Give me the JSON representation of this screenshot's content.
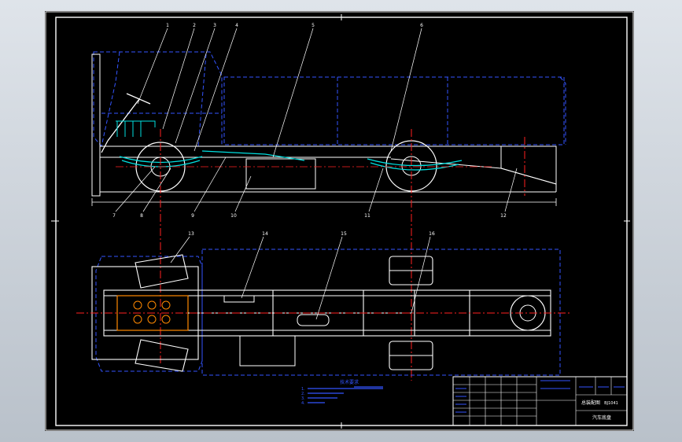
{
  "drawing": {
    "background": "#000000",
    "frame_color": "#ffffff",
    "colors": {
      "outline": "#ffffff",
      "hidden": "#3355ff",
      "center": "#ff2020",
      "spring": "#00e0e0",
      "accent": "#ffff00",
      "leader": "#ffffff"
    },
    "side_view": {
      "balloons": [
        "1",
        "2",
        "3",
        "4",
        "5",
        "6"
      ],
      "bottom_callouts": [
        "7",
        "8",
        "9",
        "10",
        "11",
        "12"
      ]
    },
    "plan_view": {
      "balloons": [
        "13",
        "14",
        "15",
        "16"
      ]
    },
    "notes": {
      "heading": "技术要求",
      "lines": [
        "1.",
        "2.",
        "3.",
        "4."
      ]
    },
    "title_block": {
      "title": "总装配图",
      "drawing_no": "BJ1041",
      "subtitle": "汽车底盘"
    }
  }
}
